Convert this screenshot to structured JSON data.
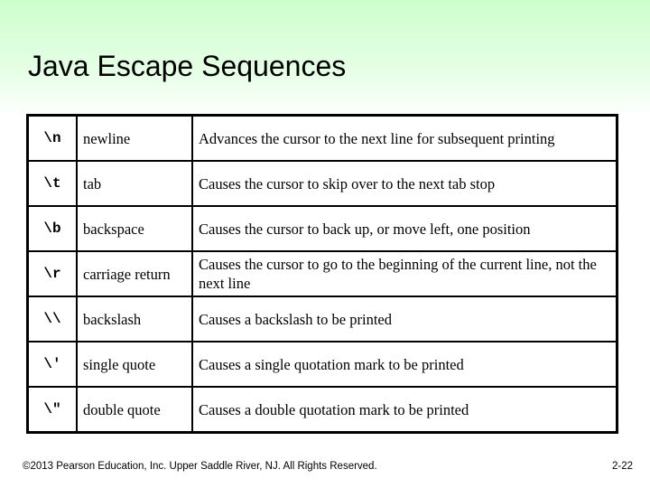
{
  "slide": {
    "title": "Java Escape Sequences",
    "background_top_color": "#ccffcc",
    "rows": [
      {
        "sequence": "\\n",
        "name": "newline",
        "description": "Advances the cursor to the next line for subsequent printing"
      },
      {
        "sequence": "\\t",
        "name": "tab",
        "description": "Causes the cursor to skip over to the next tab stop"
      },
      {
        "sequence": "\\b",
        "name": "backspace",
        "description": "Causes the cursor to back up, or move left, one position"
      },
      {
        "sequence": "\\r",
        "name": "carriage return",
        "description": "Causes the cursor to go to the beginning of the current line, not the next line"
      },
      {
        "sequence": "\\\\",
        "name": "backslash",
        "description": "Causes a backslash to be printed"
      },
      {
        "sequence": "\\′",
        "name": "single quote",
        "description": "Causes a single quotation mark to be printed"
      },
      {
        "sequence": "\\″",
        "name": "double quote",
        "description": "Causes a double quotation mark to be printed"
      }
    ],
    "footer": "©2013 Pearson Education, Inc. Upper Saddle River, NJ. All Rights Reserved.",
    "page_number": "2-22"
  }
}
